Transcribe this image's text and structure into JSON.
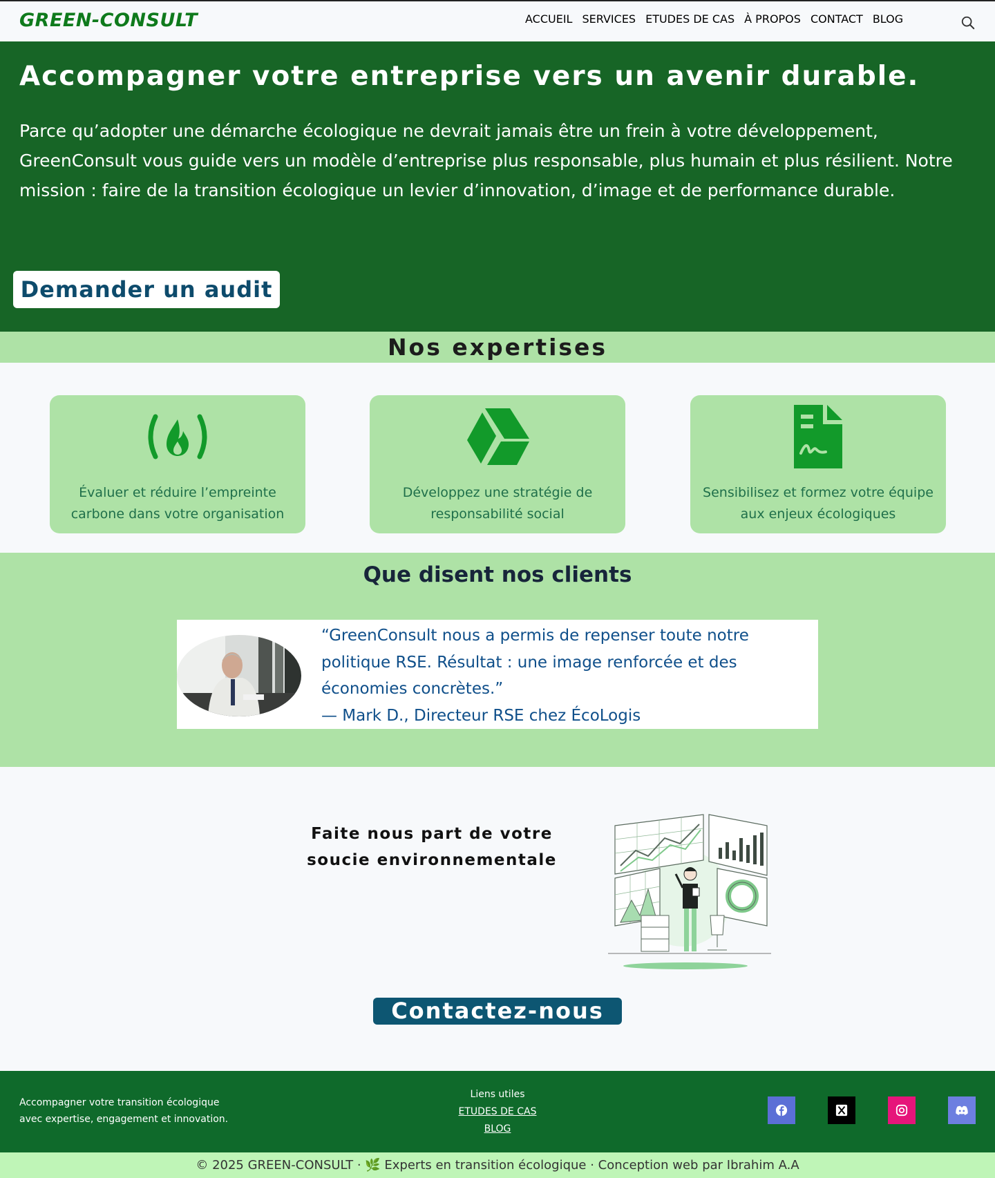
{
  "header": {
    "logo": "GREEN-CONSULT",
    "nav": [
      "ACCUEIL",
      "SERVICES",
      "ETUDES DE CAS",
      "À PROPOS",
      "CONTACT",
      "BLOG"
    ]
  },
  "hero": {
    "title": "Accompagner votre entreprise vers un avenir durable.",
    "text": "Parce qu’adopter une démarche écologique ne devrait jamais être un frein à votre développement, GreenConsult vous guide vers un modèle d’entreprise plus responsable, plus humain et plus résilient. Notre mission : faire de la transition écologique un levier d’innovation, d’image et de performance durable.",
    "button": "Demander un audit"
  },
  "expertises": {
    "title": "Nos expertises",
    "cards": [
      {
        "icon": "carbon-fire-icon",
        "text": "Évaluer et réduire l’empreinte carbone dans votre organisation"
      },
      {
        "icon": "strategy-drive-icon",
        "text": "Développez une stratégie de responsabilité social"
      },
      {
        "icon": "document-signature-icon",
        "text": "Sensibilisez et formez votre équipe aux enjeux écologiques"
      }
    ]
  },
  "testimonials": {
    "title": "Que disent nos clients",
    "quote": "“GreenConsult nous a permis de repenser toute notre politique RSE. Résultat : une image renforcée et des économies concrètes.”",
    "author": "— Mark D., Directeur RSE chez ÉcoLogis"
  },
  "contact": {
    "title": "Faite nous part de votre soucie environnementale",
    "button": "Contactez-nous"
  },
  "footer": {
    "tagline_line1": "Accompagner votre transition écologique",
    "tagline_line2": "avec expertise, engagement et innovation.",
    "links_title": "Liens utiles",
    "links": [
      "ETUDES DE CAS",
      "BLOG"
    ],
    "social": [
      {
        "icon": "facebook-icon",
        "color": "#5b6fd6"
      },
      {
        "icon": "x-icon",
        "color": "#000000"
      },
      {
        "icon": "instagram-icon",
        "color": "#e6157a"
      },
      {
        "icon": "discord-icon",
        "color": "#6d7fe0"
      }
    ],
    "copyright": "© 2025 GREEN-CONSULT · 🌿 Experts en transition écologique · Conception web par Ibrahim A.A"
  },
  "colors": {
    "brand_green": "#176526",
    "light_green": "#aee2a6",
    "accent_blue": "#0d5672"
  }
}
